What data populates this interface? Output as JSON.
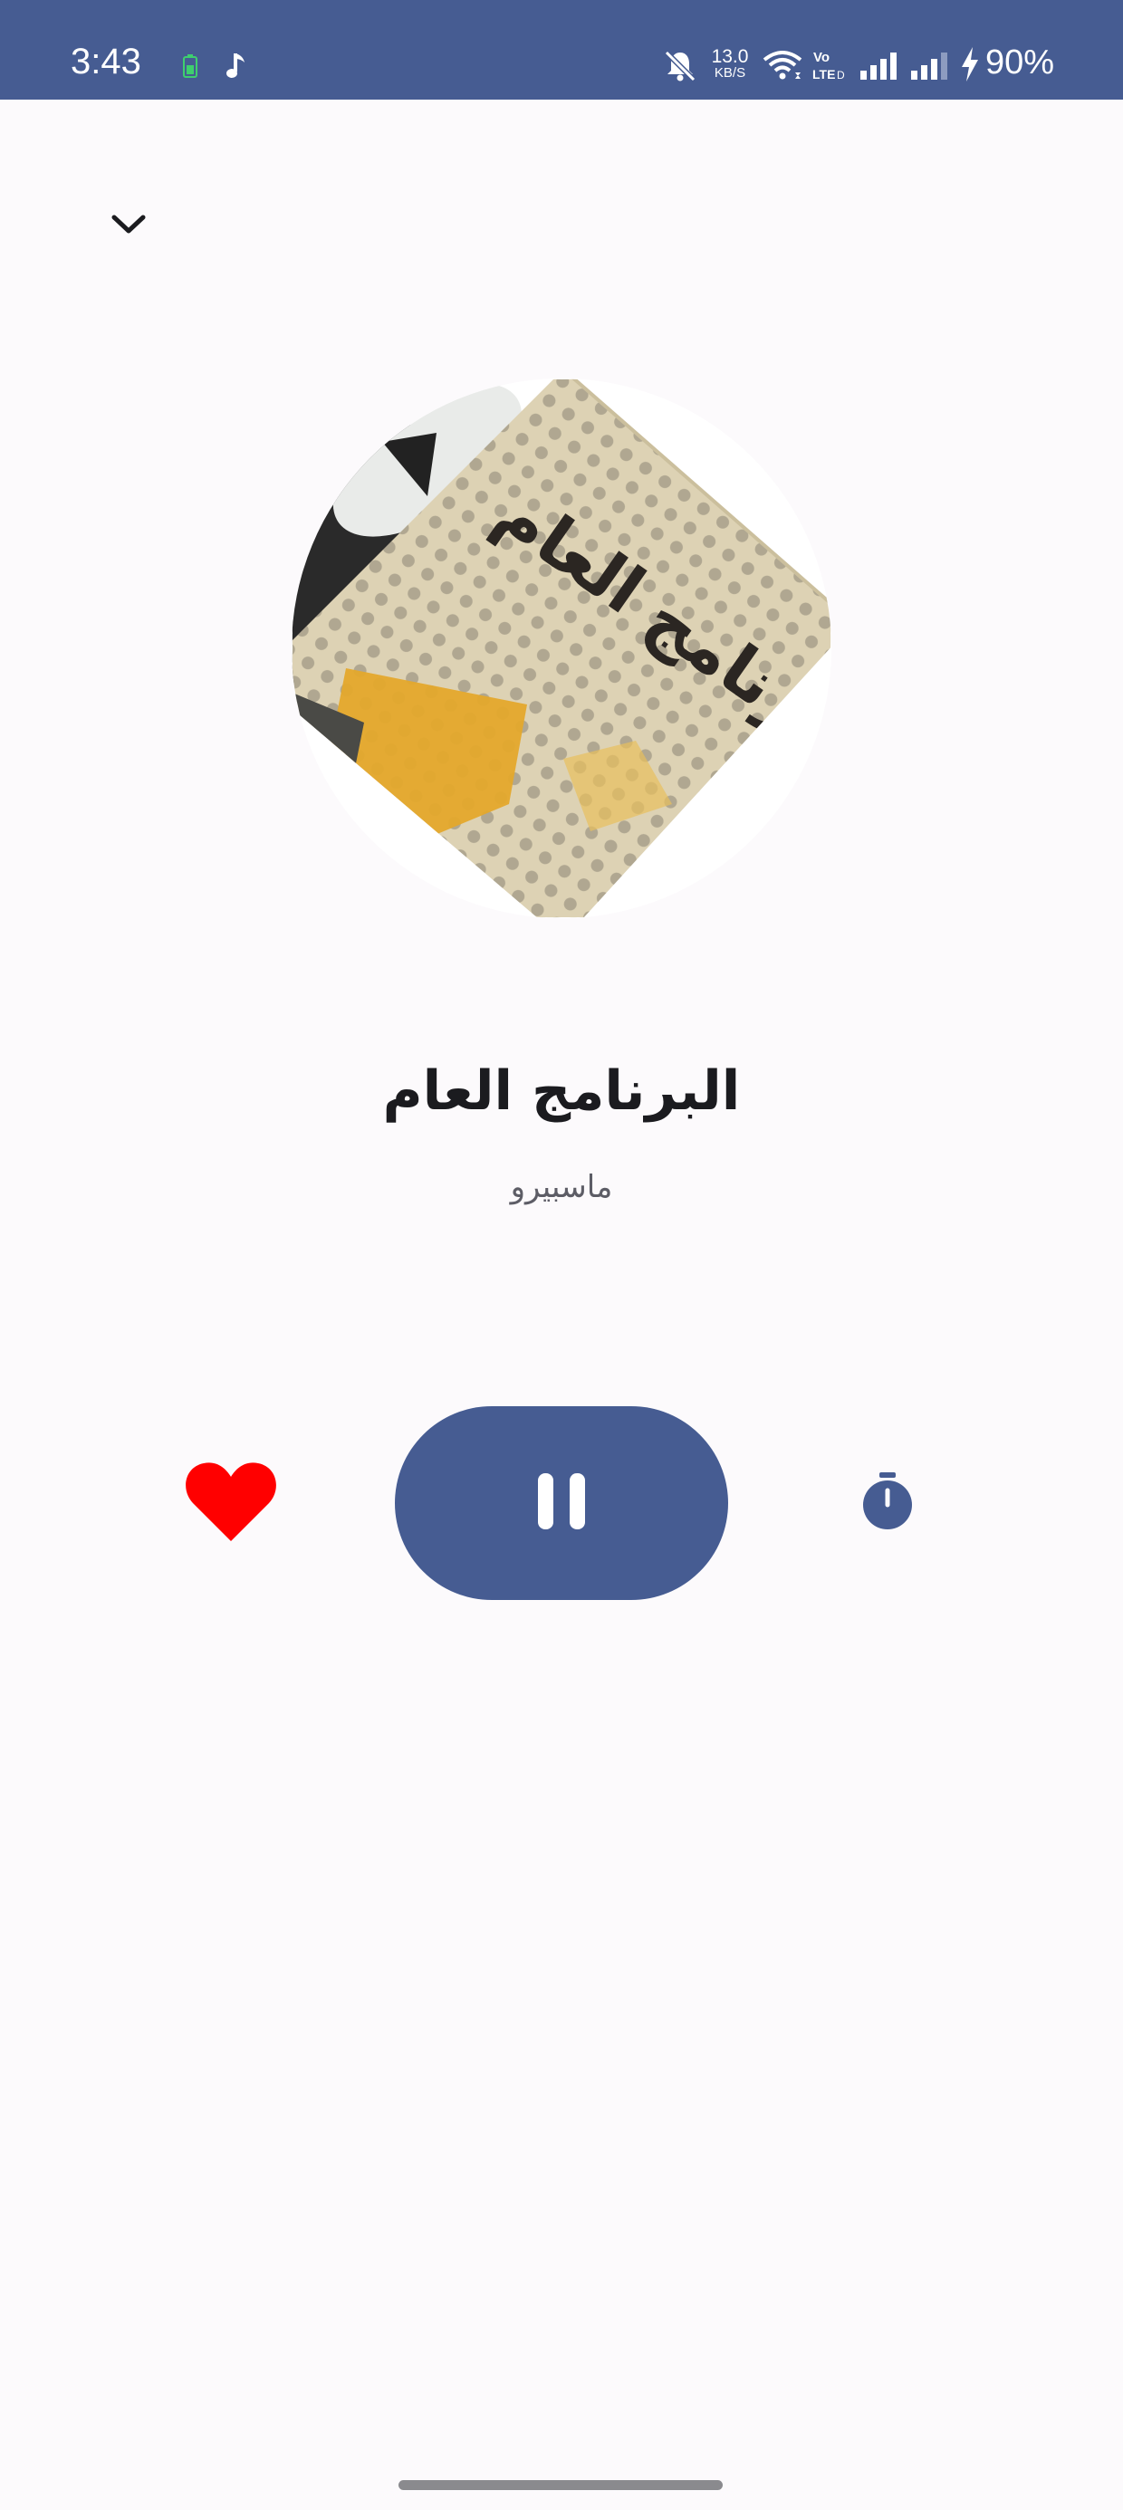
{
  "status_bar": {
    "time": "3:43",
    "net_speed_value": "13.0",
    "net_speed_unit": "KB/S",
    "battery": "90%",
    "background_color": "#465c92",
    "icons": [
      "battery-saver-icon",
      "music-note-icon",
      "mute-icon",
      "wifi-icon",
      "volte-icon",
      "signal-icon",
      "signal-icon",
      "charging-icon"
    ]
  },
  "header": {
    "collapse_icon": "chevron-down-icon"
  },
  "artwork": {
    "alt": "البرنامج العام"
  },
  "player": {
    "title": "البرنامج العام",
    "subtitle": "ماسبيرو",
    "is_playing": true,
    "is_favorite": true,
    "accent_color": "#465c92",
    "favorite_color": "#ff0000",
    "controls": [
      "heart-icon",
      "pause-icon",
      "timer-icon"
    ]
  }
}
